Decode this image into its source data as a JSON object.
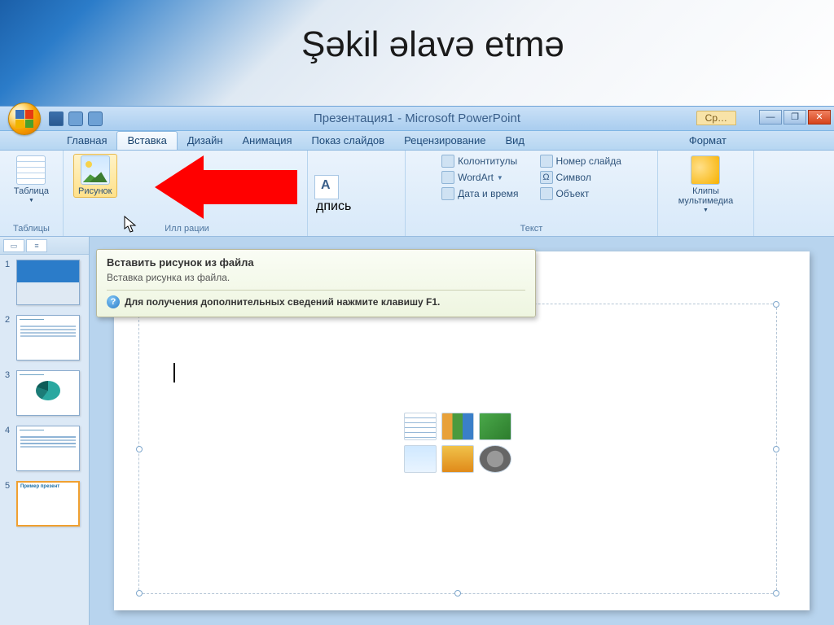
{
  "pageHeading": "Şəkil əlavə etmə",
  "window": {
    "title": "Презентация1 - Microsoft PowerPoint",
    "contextTab": "Ср…",
    "minimize": "—",
    "restore": "❐",
    "close": "✕"
  },
  "tabs": {
    "home": "Главная",
    "insert": "Вставка",
    "design": "Дизайн",
    "animation": "Анимация",
    "slideshow": "Показ слайдов",
    "review": "Рецензирование",
    "view": "Вид",
    "format": "Формат"
  },
  "ribbon": {
    "tables": {
      "button": "Таблица",
      "group": "Таблицы"
    },
    "illustrations": {
      "picture": "Рисунок",
      "group": "Илл        рации"
    },
    "textgroup": {
      "textboxSuffix": "дпись",
      "headerFooter": "Колонтитулы",
      "wordart": "WordArt",
      "datetime": "Дата и время",
      "slidenum": "Номер слайда",
      "symbol": "Символ",
      "object": "Объект",
      "group": "Текст"
    },
    "media": {
      "button": "Клипы\nмультимедиа",
      "group": ""
    }
  },
  "tooltip": {
    "title": "Вставить рисунок из файла",
    "body": "Вставка рисунка из файла.",
    "help": "Для получения дополнительных сведений нажмите клавишу F1."
  },
  "slide": {
    "title": "Пример презентации"
  },
  "thumbs": {
    "n1": "1",
    "n2": "2",
    "n3": "3",
    "n4": "4",
    "n5": "5"
  }
}
